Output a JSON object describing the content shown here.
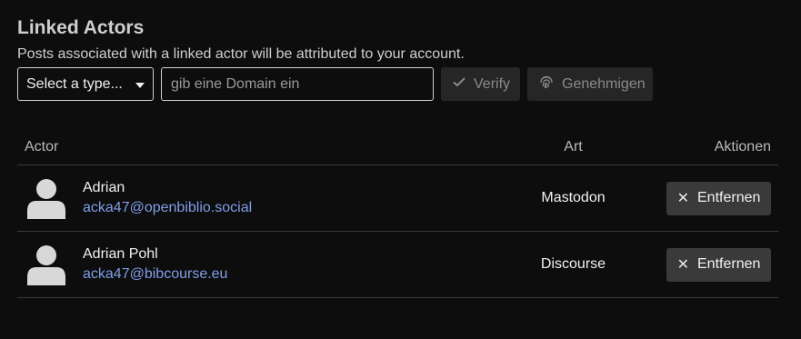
{
  "header": {
    "title": "Linked Actors",
    "subtitle": "Posts associated with a linked actor will be attributed to your account."
  },
  "controls": {
    "type_select_value": "Select a type...",
    "domain_placeholder": "gib eine Domain ein",
    "verify_label": "Verify",
    "approve_label": "Genehmigen"
  },
  "table": {
    "columns": {
      "actor": "Actor",
      "type": "Art",
      "actions": "Aktionen"
    },
    "rows": [
      {
        "name": "Adrian",
        "handle": "acka47@openbiblio.social",
        "type": "Mastodon",
        "action": "Entfernen"
      },
      {
        "name": "Adrian Pohl",
        "handle": "acka47@bibcourse.eu",
        "type": "Discourse",
        "action": "Entfernen"
      }
    ]
  },
  "colors": {
    "background": "#0e0d0d",
    "link": "#7f9ee8",
    "button": "#3a3a3a",
    "button_disabled": "#262626"
  }
}
